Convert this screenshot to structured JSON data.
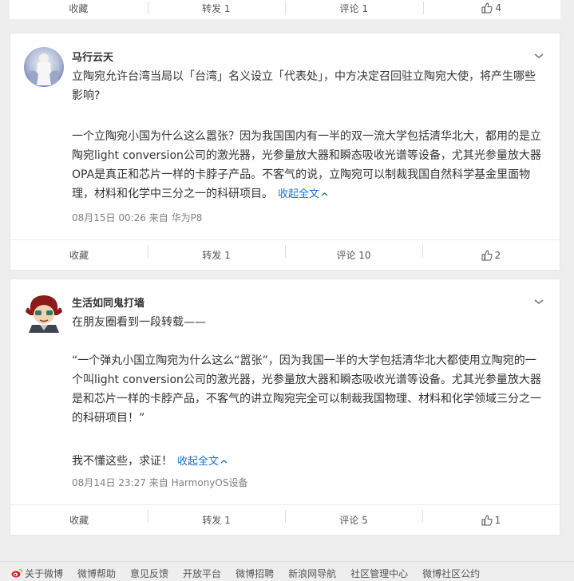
{
  "top_actions": {
    "collect": "收藏",
    "repost": "转发 1",
    "comment": "评论 1",
    "like": "4"
  },
  "posts": [
    {
      "username": "马行云天",
      "paragraphs": [
        "立陶宛允许台湾当局以「台湾」名义设立「代表处」，中方决定召回驻立陶宛大使，将产生哪些影响?",
        "一个立陶宛小国为什么这么嚣张？因为我国国内有一半的双一流大学包括清华北大，都用的是立陶宛light conversion公司的激光器，光参量放大器和瞬态吸收光谱等设备，尤其光参量放大器OPA是真正和芯片一样的卡脖子产品。不客气的说，立陶宛可以制裁我国自然科学基金里面物理，材料和化学中三分之一的科研项目。"
      ],
      "collapse_label": "收起全文",
      "meta": "08月15日 00:26  来自 华为P8",
      "actions": {
        "collect": "收藏",
        "repost": "转发 1",
        "comment": "评论 10",
        "like": "2"
      }
    },
    {
      "username": "生活如同鬼打墙",
      "paragraphs": [
        "在朋友圈看到一段转载——",
        "“一个弹丸小国立陶宛为什么这么“嚣张”，因为我国一半的大学包括清华北大都使用立陶宛的一个叫light conversion公司的激光器，光参量放大器和瞬态吸收光谱等设备。尤其光参量放大器是和芯片一样的卡脖产品，不客气的讲立陶宛完全可以制裁我国物理、材料和化学领域三分之一的科研项目！”",
        "我不懂这些，求证！"
      ],
      "collapse_label": "收起全文",
      "meta": "08月14日 23:27  来自 HarmonyOS设备",
      "actions": {
        "collect": "收藏",
        "repost": "转发 1",
        "comment": "评论 5",
        "like": "1"
      }
    }
  ],
  "footer": {
    "links": [
      "关于微博",
      "微博帮助",
      "意见反馈",
      "开放平台",
      "微博招聘",
      "新浪网导航",
      "社区管理中心",
      "微博社区公约"
    ]
  },
  "colors": {
    "link": "#1e6ec5",
    "meta": "#808080",
    "background": "#eeeeee",
    "card": "#ffffff",
    "weibo_red": "#e6162d"
  },
  "icons": [
    "like-icon",
    "chevron-down-icon",
    "weibo-logo-icon",
    "avatar"
  ]
}
